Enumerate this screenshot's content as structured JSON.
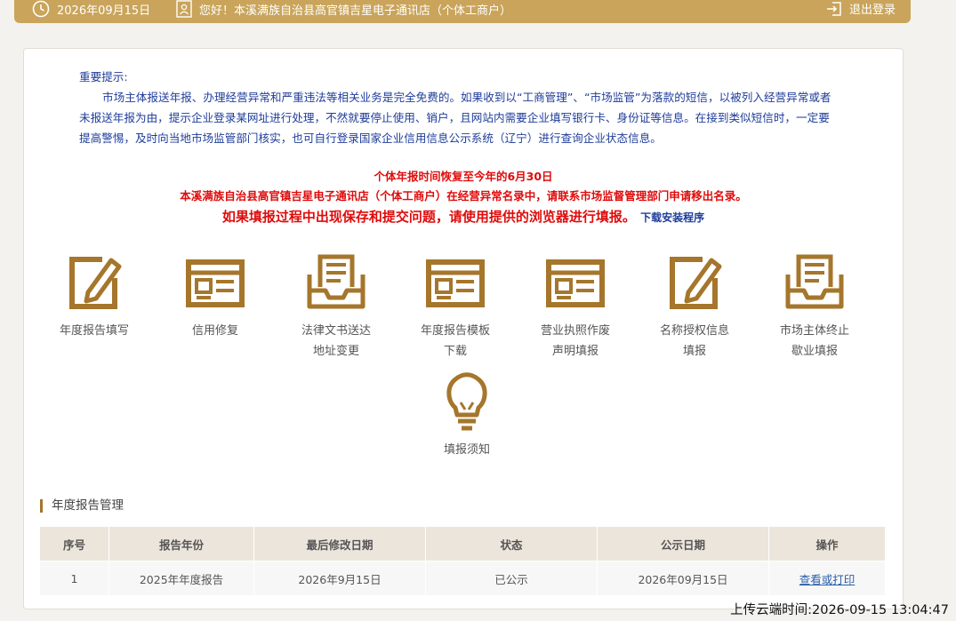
{
  "topbar": {
    "date": "2026年09月15日",
    "greeting": "您好！本溪满族自治县高官镇吉星电子通讯店（个体工商户）",
    "logout": "退出登录"
  },
  "notice": {
    "title": "重要提示:",
    "body": "市场主体报送年报、办理经营异常和严重违法等相关业务是完全免费的。如果收到以“工商管理”、“市场监管”为落款的短信，以被列入经营异常或者未报送年报为由，提示企业登录某网址进行处理，不然就要停止使用、销户，且网站内需要企业填写银行卡、身份证等信息。在接到类似短信时，一定要提高警惕，及时向当地市场监管部门核实，也可自行登录国家企业信用信息公示系统（辽宁）进行查询企业状态信息。",
    "deadline": "个体年报时间恢复至今年的6月30日",
    "abnormal": "本溪满族自治县高官镇吉星电子通讯店（个体工商户）在经营异常名录中，请联系市场监督管理部门申请移出名录。",
    "browser_tip": "如果填报过程中出现保存和提交问题，请使用提供的浏览器进行填报。",
    "download_link": "下载安装程序"
  },
  "services": [
    {
      "name": "annual-report-fill",
      "icon": "pencil-form-icon",
      "line1": "年度报告填写",
      "line2": ""
    },
    {
      "name": "credit-repair",
      "icon": "form-card-icon",
      "line1": "信用修复",
      "line2": ""
    },
    {
      "name": "legal-doc-address",
      "icon": "inbox-document-icon",
      "line1": "法律文书送达",
      "line2": "地址变更"
    },
    {
      "name": "report-template-download",
      "icon": "form-card-icon",
      "line1": "年度报告模板",
      "line2": "下载"
    },
    {
      "name": "license-void-statement",
      "icon": "form-card-icon",
      "line1": "营业执照作废",
      "line2": "声明填报"
    },
    {
      "name": "name-authorization",
      "icon": "pencil-form-icon",
      "line1": "名称授权信息",
      "line2": "填报"
    },
    {
      "name": "entity-termination",
      "icon": "inbox-document-icon",
      "line1": "市场主体终止",
      "line2": "歇业填报"
    },
    {
      "name": "filing-instructions",
      "icon": "lightbulb-icon",
      "line1": "填报须知",
      "line2": ""
    }
  ],
  "section": {
    "title": "年度报告管理",
    "columns": [
      "序号",
      "报告年份",
      "最后修改日期",
      "状态",
      "公示日期",
      "操作"
    ],
    "rows": [
      {
        "index": "1",
        "year": "2025年年度报告",
        "modified": "2026年9月15日",
        "status": "已公示",
        "published": "2026年09月15日",
        "action": "查看或打印"
      }
    ]
  },
  "upload_time": "上传云端时间:2026-09-15 13:04:47",
  "colors": {
    "gold": "#c9a45a",
    "icon_brown": "#a5762b",
    "notice_blue": "#1f3d9a",
    "alert_red": "#e00b0b"
  }
}
